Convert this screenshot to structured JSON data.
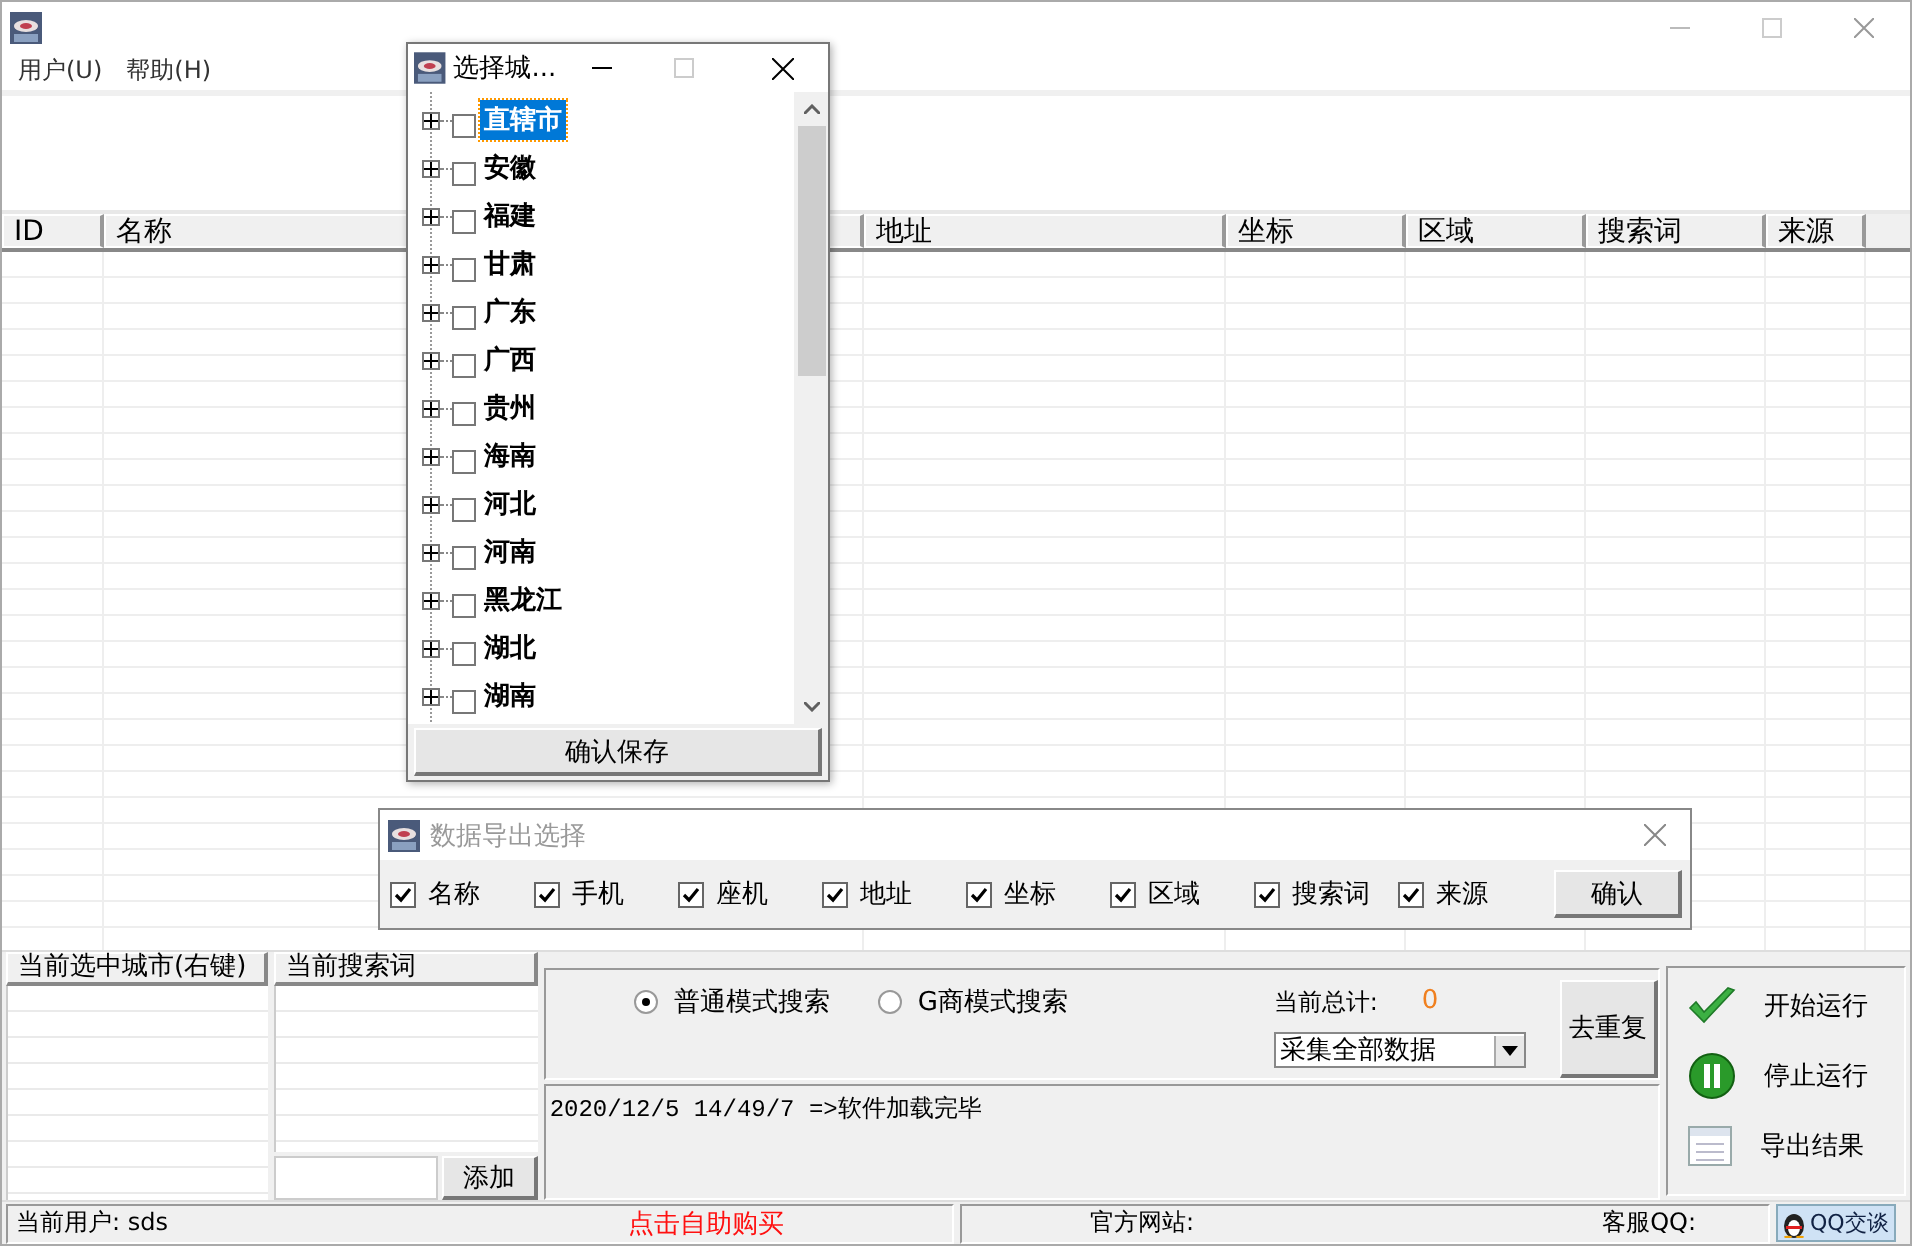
{
  "menu": [
    {
      "label": "用户(U)"
    },
    {
      "label": "帮助(H)"
    }
  ],
  "table": {
    "columns": [
      {
        "label": "ID"
      },
      {
        "label": "名称"
      },
      {
        "label": "地址"
      },
      {
        "label": "坐标"
      },
      {
        "label": "区域"
      },
      {
        "label": "搜索词"
      },
      {
        "label": "来源"
      }
    ]
  },
  "city_panel": {
    "header": "当前选中城市(右键)"
  },
  "keyword_panel": {
    "header": "当前搜索词",
    "add_button": "添加"
  },
  "search_modes": [
    {
      "label": "普通模式搜索",
      "selected": true
    },
    {
      "label": "G商模式搜索",
      "selected": false
    }
  ],
  "total": {
    "label": "当前总计:",
    "value": "0"
  },
  "collect_select": {
    "value": "采集全部数据"
  },
  "dedupe_button": "去重复",
  "log": [
    "2020/12/5 14/49/7 =>软件加载完毕"
  ],
  "actions": [
    {
      "kind": "start",
      "label": "开始运行"
    },
    {
      "kind": "stop",
      "label": "停止运行"
    },
    {
      "kind": "export",
      "label": "导出结果"
    }
  ],
  "status_bar": {
    "user": "当前用户: sds",
    "buy_link": "点击自助购买",
    "website": "官方网站:",
    "support_qq": "客服QQ:",
    "qq_chat": "QQ交谈"
  },
  "city_dialog": {
    "title": "选择城...",
    "provinces": [
      {
        "name": "直辖市",
        "checked": false,
        "selected": true,
        "expanded": false
      },
      {
        "name": "安徽",
        "checked": false,
        "selected": false,
        "expanded": false
      },
      {
        "name": "福建",
        "checked": false,
        "selected": false,
        "expanded": false
      },
      {
        "name": "甘肃",
        "checked": false,
        "selected": false,
        "expanded": false
      },
      {
        "name": "广东",
        "checked": false,
        "selected": false,
        "expanded": false
      },
      {
        "name": "广西",
        "checked": false,
        "selected": false,
        "expanded": false
      },
      {
        "name": "贵州",
        "checked": false,
        "selected": false,
        "expanded": false
      },
      {
        "name": "海南",
        "checked": false,
        "selected": false,
        "expanded": false
      },
      {
        "name": "河北",
        "checked": false,
        "selected": false,
        "expanded": false
      },
      {
        "name": "河南",
        "checked": false,
        "selected": false,
        "expanded": false
      },
      {
        "name": "黑龙江",
        "checked": false,
        "selected": false,
        "expanded": false
      },
      {
        "name": "湖北",
        "checked": false,
        "selected": false,
        "expanded": false
      },
      {
        "name": "湖南",
        "checked": false,
        "selected": false,
        "expanded": false
      }
    ],
    "save_button": "确认保存"
  },
  "export_dialog": {
    "title": "数据导出选择",
    "fields": [
      {
        "label": "名称",
        "checked": true
      },
      {
        "label": "手机",
        "checked": true
      },
      {
        "label": "座机",
        "checked": true
      },
      {
        "label": "地址",
        "checked": true
      },
      {
        "label": "坐标",
        "checked": true
      },
      {
        "label": "区域",
        "checked": true
      },
      {
        "label": "搜索词",
        "checked": true
      },
      {
        "label": "来源",
        "checked": true
      }
    ],
    "confirm_button": "确认"
  }
}
